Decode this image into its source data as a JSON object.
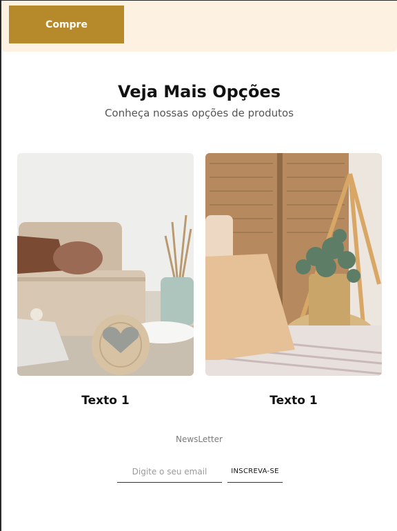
{
  "header": {
    "buy_button_label": "Compre"
  },
  "section": {
    "title": "Veja Mais Opções",
    "subtitle": "Conheça nossas opções de produtos"
  },
  "cards": [
    {
      "caption": "Texto 1",
      "image": "living-room-sofa-photo"
    },
    {
      "caption": "Texto 1",
      "image": "bedroom-plant-pillow-photo"
    }
  ],
  "newsletter": {
    "label": "NewsLetter",
    "email_placeholder": "Digite o seu email",
    "subscribe_label": "INSCREVA-SE"
  },
  "colors": {
    "header_bg": "#fdf1e1",
    "accent": "#b68a2b"
  }
}
